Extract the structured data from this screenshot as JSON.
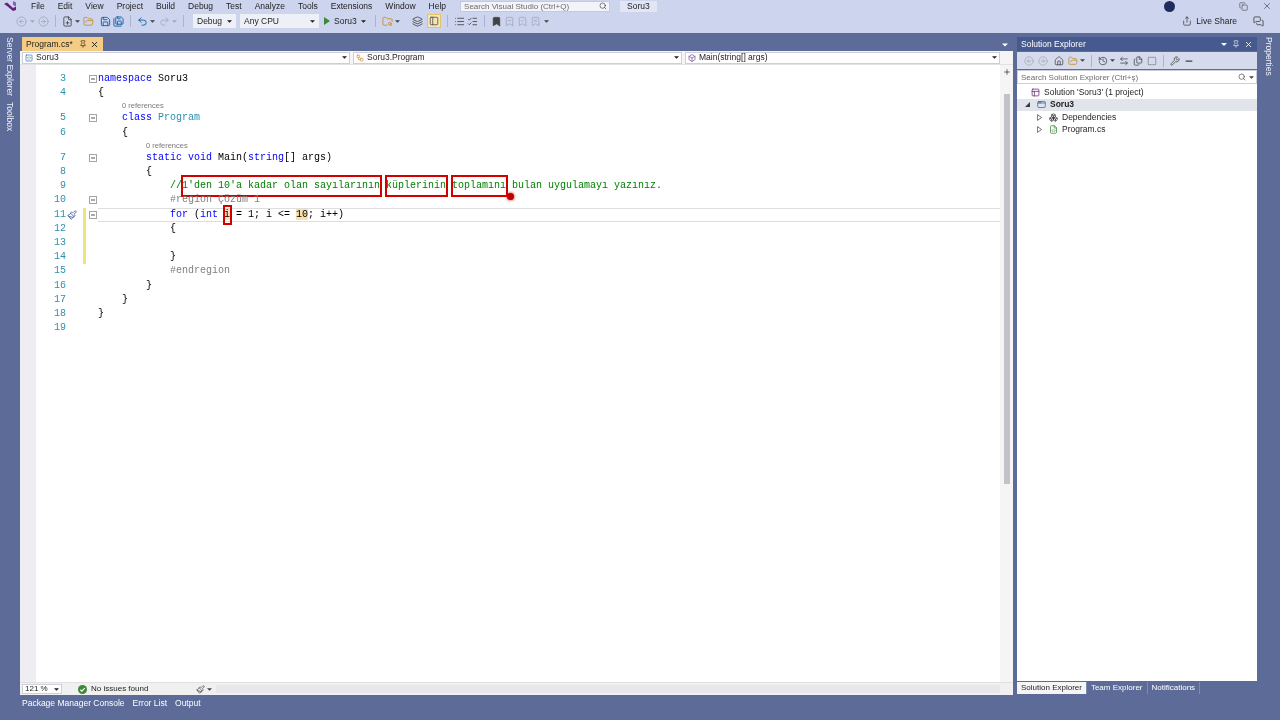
{
  "menu_bar": {
    "items": [
      "File",
      "Edit",
      "View",
      "Project",
      "Build",
      "Debug",
      "Test",
      "Analyze",
      "Tools",
      "Extensions",
      "Window",
      "Help"
    ],
    "search": {
      "placeholder": "Search Visual Studio (Ctrl+Q)"
    },
    "solution_name": "Soru3"
  },
  "toolbar": {
    "configuration": "Debug",
    "platform": "Any CPU",
    "start_label": "Soru3",
    "live_share": "Live Share"
  },
  "left_side_tabs": [
    "Server Explorer",
    "Toolbox"
  ],
  "right_side_tabs": [
    "Properties"
  ],
  "editor": {
    "tabs": [
      {
        "label": "Program.cs*",
        "selected": true
      }
    ],
    "navigation": [
      {
        "label": "Soru3",
        "kind": "project"
      },
      {
        "label": "Soru3.Program",
        "kind": "class"
      },
      {
        "label": "Main(string[] args)",
        "kind": "method"
      }
    ],
    "lines": [
      {
        "kind": "code",
        "number": "3",
        "fold": true,
        "modified": false,
        "current": false,
        "tokens": [
          {
            "text": "namespace",
            "kind": "keyword"
          },
          {
            "text": " Soru3",
            "kind": "plain"
          }
        ]
      },
      {
        "kind": "code",
        "number": "4",
        "fold": false,
        "modified": false,
        "current": false,
        "tokens": [
          {
            "text": "{",
            "kind": "plain"
          }
        ],
        "children": [
          {
            "kind": "codelens",
            "text": "0 references"
          },
          {
            "kind": "code",
            "number": "5",
            "fold": true,
            "modified": false,
            "current": false,
            "tokens": [
              {
                "text": "class",
                "kind": "keyword"
              },
              {
                "text": " Program",
                "kind": "type"
              }
            ]
          },
          {
            "kind": "code",
            "number": "6",
            "fold": false,
            "modified": false,
            "current": false,
            "tokens": [
              {
                "text": "{",
                "kind": "plain"
              }
            ],
            "children": [
              {
                "kind": "codelens",
                "text": "0 references"
              },
              {
                "kind": "code",
                "number": "7",
                "fold": true,
                "modified": false,
                "current": false,
                "tokens": [
                  {
                    "text": "static",
                    "kind": "keyword"
                  },
                  {
                    "text": " void",
                    "kind": "keyword"
                  },
                  {
                    "text": " Main(",
                    "kind": "plain"
                  },
                  {
                    "text": "string",
                    "kind": "keyword"
                  },
                  {
                    "text": "[] args)",
                    "kind": "plain"
                  }
                ]
              },
              {
                "kind": "code",
                "number": "8",
                "fold": false,
                "modified": false,
                "current": false,
                "tokens": [
                  {
                    "text": "{",
                    "kind": "plain"
                  }
                ],
                "children": [
                  {
                    "kind": "code",
                    "number": "9",
                    "fold": false,
                    "modified": false,
                    "current": false,
                    "tokens": [
                      {
                        "text": "//",
                        "kind": "comment",
                        "annotated": false,
                        "pointer": false
                      },
                      {
                        "text": "1'den 10'a kadar olan sayılarının",
                        "kind": "comment",
                        "annotated": true,
                        "pointer": false
                      },
                      {
                        "text": " küplerinin",
                        "kind": "comment",
                        "annotated": true,
                        "pointer": false
                      },
                      {
                        "text": " toplamını",
                        "kind": "comment",
                        "annotated": true,
                        "pointer": true
                      },
                      {
                        "text": " bulan uygulamayı yazınız.",
                        "kind": "comment",
                        "annotated": false,
                        "pointer": false
                      }
                    ]
                  },
                  {
                    "kind": "code",
                    "number": "10",
                    "fold": true,
                    "modified": false,
                    "current": false,
                    "tokens": [
                      {
                        "text": "#region Çözüm 1",
                        "kind": "preproc"
                      }
                    ]
                  },
                  {
                    "kind": "code",
                    "number": "11",
                    "fold": true,
                    "modified": true,
                    "current": true,
                    "tokens": [
                      {
                        "text": "for",
                        "kind": "keyword",
                        "highlighted": false,
                        "annotated": false
                      },
                      {
                        "text": " (",
                        "kind": "plain",
                        "highlighted": false,
                        "annotated": false
                      },
                      {
                        "text": "int ",
                        "kind": "keyword",
                        "highlighted": false,
                        "annotated": false
                      },
                      {
                        "text": "i",
                        "kind": "plain",
                        "highlighted": true,
                        "annotated": true
                      },
                      {
                        "text": " = 1; i <= ",
                        "kind": "plain",
                        "highlighted": false,
                        "annotated": false
                      },
                      {
                        "text": "10",
                        "kind": "plain",
                        "highlighted": true,
                        "annotated": false
                      },
                      {
                        "text": "; i++)",
                        "kind": "plain",
                        "highlighted": false,
                        "annotated": false
                      }
                    ]
                  },
                  {
                    "kind": "code",
                    "number": "12",
                    "fold": false,
                    "modified": true,
                    "current": false,
                    "tokens": [
                      {
                        "text": "{",
                        "kind": "plain"
                      }
                    ],
                    "children": [
                      {
                        "kind": "code",
                        "number": "13",
                        "fold": false,
                        "modified": true,
                        "current": false
                      }
                    ]
                  },
                  {
                    "kind": "code",
                    "number": "14",
                    "fold": false,
                    "modified": true,
                    "current": false,
                    "tokens": [
                      {
                        "text": "}",
                        "kind": "plain"
                      }
                    ]
                  },
                  {
                    "kind": "code",
                    "number": "15",
                    "fold": false,
                    "modified": false,
                    "current": false,
                    "tokens": [
                      {
                        "text": "#endregion",
                        "kind": "preproc"
                      }
                    ]
                  }
                ]
              },
              {
                "kind": "code",
                "number": "16",
                "fold": false,
                "modified": false,
                "current": false,
                "tokens": [
                  {
                    "text": "}",
                    "kind": "plain"
                  }
                ]
              }
            ]
          },
          {
            "kind": "code",
            "number": "17",
            "fold": false,
            "modified": false,
            "current": false,
            "tokens": [
              {
                "text": "}",
                "kind": "plain"
              }
            ]
          }
        ]
      },
      {
        "kind": "code",
        "number": "18",
        "fold": false,
        "modified": false,
        "current": false,
        "tokens": [
          {
            "text": "}",
            "kind": "plain"
          }
        ]
      },
      {
        "kind": "code",
        "number": "19",
        "fold": false,
        "modified": false,
        "current": false
      }
    ],
    "zoom": "121 %",
    "status": "No issues found"
  },
  "solution_explorer": {
    "title": "Solution Explorer",
    "search": {
      "placeholder": "Search Solution Explorer (Ctrl+ş)"
    },
    "tree": [
      {
        "label": "Solution 'Soru3' (1 project)",
        "kind": "solution",
        "selected": false,
        "children": [
          {
            "label": "Soru3",
            "kind": "project",
            "expanded": true,
            "selected": true,
            "children": [
              {
                "label": "Dependencies",
                "kind": "dependencies",
                "expanded": false,
                "selected": false
              },
              {
                "label": "Program.cs",
                "kind": "csharp_file",
                "expanded": false,
                "selected": false
              }
            ]
          }
        ]
      }
    ],
    "tabs": [
      {
        "label": "Solution Explorer",
        "selected": true
      },
      {
        "label": "Team Explorer",
        "selected": false
      },
      {
        "label": "Notifications",
        "selected": false
      }
    ]
  },
  "bottom_tabs": [
    "Package Manager Console",
    "Error List",
    "Output"
  ]
}
